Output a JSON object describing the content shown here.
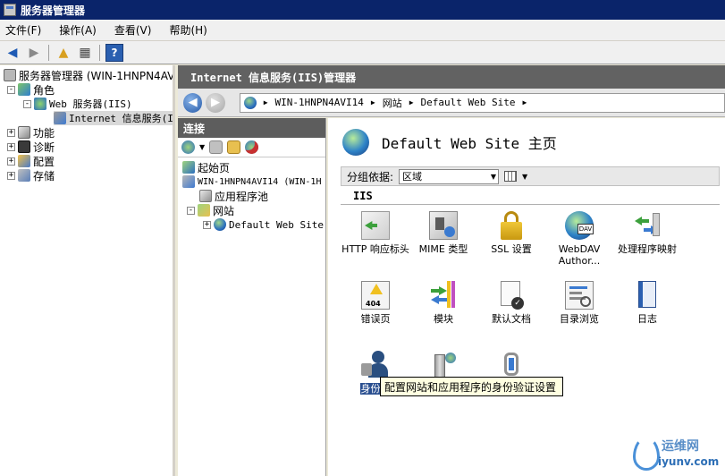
{
  "window": {
    "title": "服务器管理器"
  },
  "menu": [
    "文件(F)",
    "操作(A)",
    "查看(V)",
    "帮助(H)"
  ],
  "tree": {
    "root": "服务器管理器 (WIN-1HNPN4AVI1",
    "roles": "角色",
    "web_server": "Web 服务器(IIS)",
    "iis": "Internet 信息服务(I",
    "features": "功能",
    "diagnostics": "诊断",
    "config": "配置",
    "storage": "存储"
  },
  "iis": {
    "header": "Internet 信息服务(IIS)管理器",
    "breadcrumb": [
      "WIN-1HNPN4AVI14",
      "网站",
      "Default Web Site"
    ]
  },
  "connections": {
    "title": "连接",
    "start_page": "起始页",
    "server": "WIN-1HNPN4AVI14 (WIN-1H",
    "app_pools": "应用程序池",
    "sites": "网站",
    "default_site": "Default Web Site"
  },
  "home": {
    "title": "Default Web Site 主页",
    "group_label": "分组依据:",
    "group_value": "区域",
    "section": "IIS"
  },
  "features": {
    "http": "HTTP 响应标头",
    "mime": "MIME 类型",
    "ssl": "SSL 设置",
    "webdav": "WebDAV Author...",
    "handler": "处理程序映射",
    "error": "错误页",
    "modules": "模块",
    "default_doc": "默认文档",
    "dir_browse": "目录浏览",
    "logging": "日志",
    "auth": "身份验"
  },
  "tooltip": "配置网站和应用程序的身份验证设置",
  "watermark": {
    "cn": "运维网",
    "en": "iyunv.com"
  }
}
